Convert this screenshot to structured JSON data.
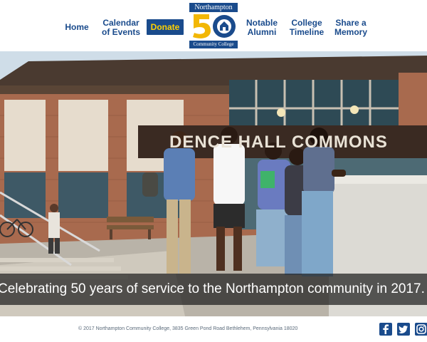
{
  "nav": {
    "home": "Home",
    "calendar": "Calendar\nof Events",
    "donate": "Donate",
    "alumni": "Notable\nAlumni",
    "timeline": "College\nTimeline",
    "memory": "Share a\nMemory"
  },
  "logo": {
    "top_text": "Northampton",
    "number": "50",
    "bottom_text": "Community College"
  },
  "hero": {
    "sign_text": "DENCE HALL COMMONS",
    "caption": "Celebrating 50 years of service to the Northampton community in 2017."
  },
  "footer": {
    "copyright": "© 2017 Northampton Community College, 3835 Green Pond Road Bethlehem, Pennsylvania 18020",
    "social_icons": [
      "facebook-icon",
      "twitter-icon",
      "instagram-icon"
    ]
  },
  "colors": {
    "nav_blue": "#1a4b8c",
    "donate_yellow": "#ffd100",
    "logo_gold": "#f2b705"
  }
}
